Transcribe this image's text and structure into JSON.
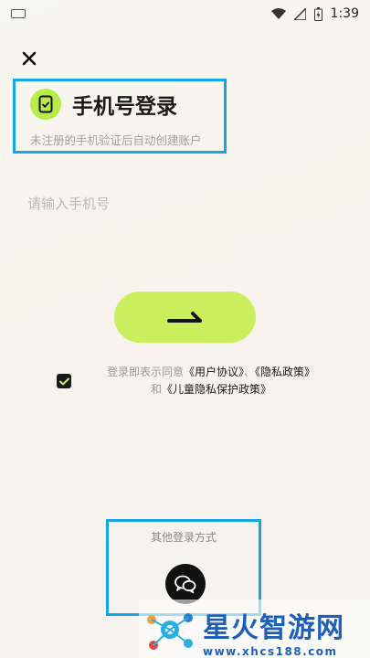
{
  "status_bar": {
    "time": "1:39"
  },
  "header": {
    "title": "手机号登录",
    "subtitle": "未注册的手机验证后自动创建账户"
  },
  "phone": {
    "placeholder": "请输入手机号",
    "value": ""
  },
  "agreement": {
    "prefix": "登录即表示同意",
    "user_agreement": "《用户协议》",
    "separator": "、",
    "privacy_policy": "《隐私政策》",
    "and": "和",
    "children_policy": "《儿童隐私保护政策》",
    "checked": true
  },
  "other_login": {
    "label": "其他登录方式"
  },
  "watermark": {
    "title": "星火智游网",
    "url": "www.xhcs188.com"
  },
  "colors": {
    "accent": "#c9f05c",
    "highlight_box": "#13a6e3",
    "dark": "#1a1a1a"
  }
}
